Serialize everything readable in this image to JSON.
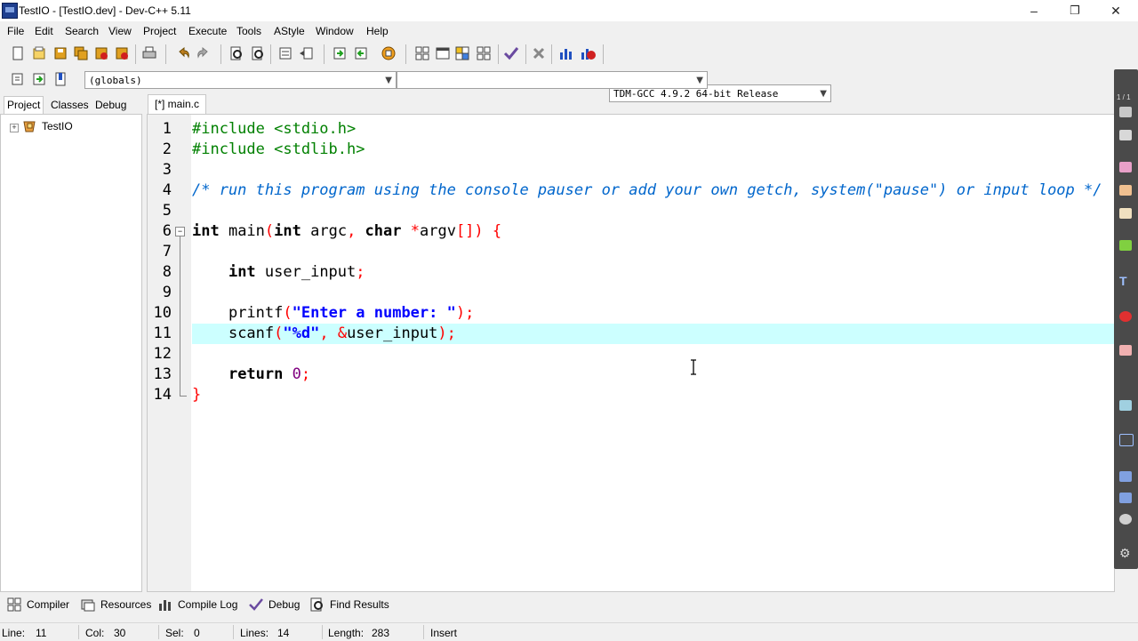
{
  "window": {
    "title": "TestIO - [TestIO.dev] - Dev-C++ 5.11",
    "minimize": "–",
    "restore": "❐",
    "close": "✕"
  },
  "menu": [
    "File",
    "Edit",
    "Search",
    "View",
    "Project",
    "Execute",
    "Tools",
    "AStyle",
    "Window",
    "Help"
  ],
  "toolbar": {
    "compiler_select": "TDM-GCC 4.9.2 64-bit Release",
    "scope_select": "(globals)",
    "function_select": ""
  },
  "left_panel": {
    "tabs": [
      "Project",
      "Classes",
      "Debug"
    ],
    "active_tab": "Project",
    "tree_root": "TestIO",
    "expander": "+"
  },
  "editor": {
    "tab_label": "[*] main.c",
    "current_line": 11,
    "lines": [
      {
        "n": "1"
      },
      {
        "n": "2"
      },
      {
        "n": "3"
      },
      {
        "n": "4"
      },
      {
        "n": "5"
      },
      {
        "n": "6"
      },
      {
        "n": "7"
      },
      {
        "n": "8"
      },
      {
        "n": "9"
      },
      {
        "n": "10"
      },
      {
        "n": "11"
      },
      {
        "n": "12"
      },
      {
        "n": "13"
      },
      {
        "n": "14"
      }
    ],
    "code": {
      "l1": "#include <stdio.h>",
      "l2": "#include <stdlib.h>",
      "l4": "/* run this program using the console pauser or add your own getch, system(\"pause\") or input loop */",
      "l6_int": "int",
      "l6_main": " main",
      "l6_p1": "(",
      "l6_int2": "int",
      "l6_argc": " argc",
      "l6_comma": ",",
      "l6_char": " char",
      "l6_star": " *",
      "l6_argv": "argv",
      "l6_rest": "[]) {",
      "l8_int": "int",
      "l8_var": " user_input",
      "l8_semi": ";",
      "l10_fn": "printf",
      "l10_p1": "(",
      "l10_str": "\"Enter a number: \"",
      "l10_end": ");",
      "l11_fn": "scanf",
      "l11_p1": "(",
      "l11_str": "\"%d\"",
      "l11_comma": ", &",
      "l11_var": "user_input",
      "l11_end": ");",
      "l13_ret": "return",
      "l13_num": " 0",
      "l13_semi": ";",
      "l14": "}"
    },
    "fold_open": "−"
  },
  "bottom_tabs": [
    "Compiler",
    "Resources",
    "Compile Log",
    "Debug",
    "Find Results"
  ],
  "status": {
    "line_label": "Line:",
    "line_val": "11",
    "col_label": "Col:",
    "col_val": "30",
    "sel_label": "Sel:",
    "sel_val": "0",
    "lines_label": "Lines:",
    "lines_val": "14",
    "length_label": "Length:",
    "length_val": "283",
    "mode": "Insert"
  },
  "sidebar": {
    "page": "1 / 1"
  },
  "colors": {
    "current_line": "#ccffff",
    "preprocessor": "#008000",
    "comment": "#0066cc",
    "string": "#0000ff",
    "symbol": "#ff0000",
    "number": "#800080"
  }
}
